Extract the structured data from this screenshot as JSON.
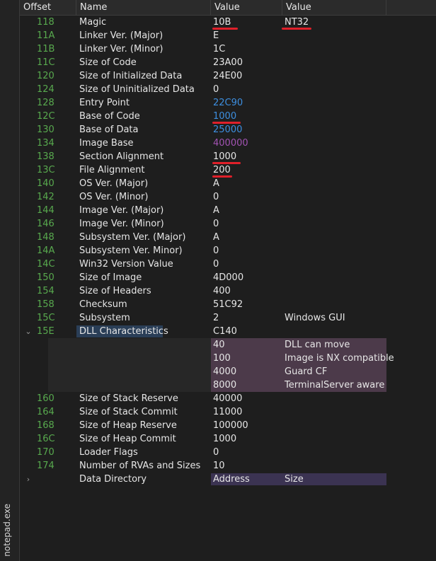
{
  "sidebar": {
    "file_label": "notepad.exe"
  },
  "header": {
    "offset": "Offset",
    "name": "Name",
    "value": "Value",
    "value2": "Value"
  },
  "rows": [
    {
      "offset": "118",
      "name": "Magic",
      "value": "10B",
      "value2": "NT32"
    },
    {
      "offset": "11A",
      "name": "Linker Ver. (Major)",
      "value": "E",
      "value2": ""
    },
    {
      "offset": "11B",
      "name": "Linker Ver. (Minor)",
      "value": "1C",
      "value2": ""
    },
    {
      "offset": "11C",
      "name": "Size of Code",
      "value": "23A00",
      "value2": ""
    },
    {
      "offset": "120",
      "name": "Size of Initialized Data",
      "value": "24E00",
      "value2": ""
    },
    {
      "offset": "124",
      "name": "Size of Uninitialized Data",
      "value": "0",
      "value2": ""
    },
    {
      "offset": "128",
      "name": "Entry Point",
      "value": "22C90",
      "value2": ""
    },
    {
      "offset": "12C",
      "name": "Base of Code",
      "value": "1000",
      "value2": ""
    },
    {
      "offset": "130",
      "name": "Base of Data",
      "value": "25000",
      "value2": ""
    },
    {
      "offset": "134",
      "name": "Image Base",
      "value": "400000",
      "value2": ""
    },
    {
      "offset": "138",
      "name": "Section Alignment",
      "value": "1000",
      "value2": ""
    },
    {
      "offset": "13C",
      "name": "File Alignment",
      "value": "200",
      "value2": ""
    },
    {
      "offset": "140",
      "name": "OS Ver. (Major)",
      "value": "A",
      "value2": ""
    },
    {
      "offset": "142",
      "name": "OS Ver. (Minor)",
      "value": "0",
      "value2": ""
    },
    {
      "offset": "144",
      "name": "Image Ver. (Major)",
      "value": "A",
      "value2": ""
    },
    {
      "offset": "146",
      "name": "Image Ver. (Minor)",
      "value": "0",
      "value2": ""
    },
    {
      "offset": "148",
      "name": "Subsystem Ver. (Major)",
      "value": "A",
      "value2": ""
    },
    {
      "offset": "14A",
      "name": "Subsystem Ver. Minor)",
      "value": "0",
      "value2": ""
    },
    {
      "offset": "14C",
      "name": "Win32 Version Value",
      "value": "0",
      "value2": ""
    },
    {
      "offset": "150",
      "name": "Size of Image",
      "value": "4D000",
      "value2": ""
    },
    {
      "offset": "154",
      "name": "Size of Headers",
      "value": "400",
      "value2": ""
    },
    {
      "offset": "158",
      "name": "Checksum",
      "value": "51C92",
      "value2": ""
    },
    {
      "offset": "15C",
      "name": "Subsystem",
      "value": "2",
      "value2": "Windows GUI"
    },
    {
      "offset": "15E",
      "name": "DLL Characteristics",
      "value": "C140",
      "value2": ""
    }
  ],
  "dll_flags": [
    {
      "value": "40",
      "desc": "DLL can move"
    },
    {
      "value": "100",
      "desc": "Image is NX compatible"
    },
    {
      "value": "4000",
      "desc": "Guard CF"
    },
    {
      "value": "8000",
      "desc": "TerminalServer aware"
    }
  ],
  "rows2": [
    {
      "offset": "160",
      "name": "Size of Stack Reserve",
      "value": "40000"
    },
    {
      "offset": "164",
      "name": "Size of Stack Commit",
      "value": "11000"
    },
    {
      "offset": "168",
      "name": "Size of Heap Reserve",
      "value": "100000"
    },
    {
      "offset": "16C",
      "name": "Size of Heap Commit",
      "value": "1000"
    },
    {
      "offset": "170",
      "name": "Loader Flags",
      "value": "0"
    },
    {
      "offset": "174",
      "name": "Number of RVAs and Sizes",
      "value": "10"
    }
  ],
  "data_directory": {
    "name": "Data Directory",
    "value": "Address",
    "value2": "Size"
  },
  "colors": {
    "offset_green": "#58a94e",
    "link_blue": "#3d8fe0",
    "imagebase_purple": "#a253b3",
    "annotation_red": "#e0202a",
    "selection": "#2a3e57"
  },
  "icons": {
    "expanded": "chevron-down-icon",
    "collapsed": "chevron-right-icon"
  }
}
